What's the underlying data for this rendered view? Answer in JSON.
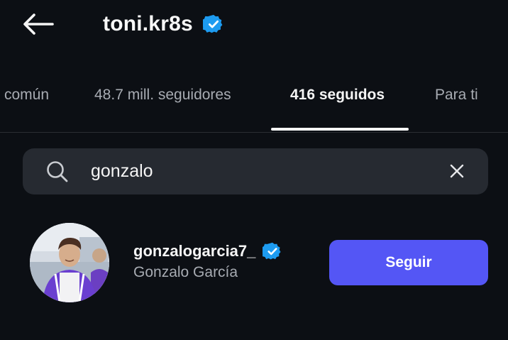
{
  "header": {
    "back_icon": "arrow-left-icon",
    "title": "toni.kr8s",
    "verified_icon": "verified-badge-icon",
    "verified_color": "#1d9bf0"
  },
  "tabs": [
    {
      "label": "común",
      "active": false
    },
    {
      "label": "48.7 mill. seguidores",
      "active": false
    },
    {
      "label": "416 seguidos",
      "active": true
    },
    {
      "label": "Para ti",
      "active": false
    }
  ],
  "search": {
    "icon": "search-icon",
    "value": "gonzalo",
    "clear_icon": "close-icon"
  },
  "results": [
    {
      "username": "gonzalogarcia7_",
      "full_name": "Gonzalo García",
      "verified": true,
      "avatar_icon": "avatar-photo",
      "button_label": "Seguir",
      "button_color": "#5456f5"
    }
  ],
  "colors": {
    "background": "#0c0f14",
    "search_bg": "#262a31",
    "text_primary": "#f5f5f5",
    "text_secondary": "#a7abb2",
    "accent": "#5456f5"
  }
}
